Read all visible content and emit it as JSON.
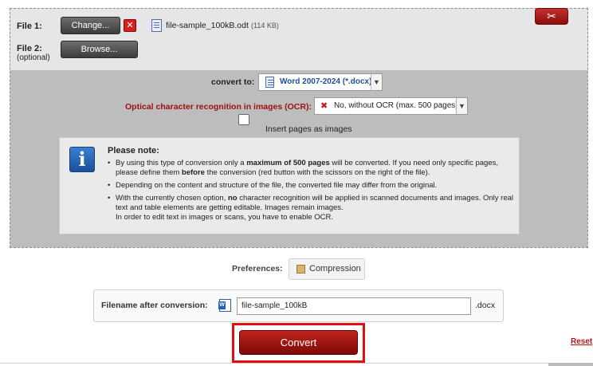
{
  "file1": {
    "label": "File 1:",
    "change_label": "Change...",
    "remove_icon": "x-icon",
    "file_name": "file-sample_100kB.odt",
    "file_size": "(114 KB)"
  },
  "file2": {
    "label": "File 2:",
    "optional_label": "(optional)",
    "browse_label": "Browse..."
  },
  "scissors_icon": "scissors-icon",
  "convert_to": {
    "label": "convert to:",
    "selected": "Word 2007-2024 (*.docx)"
  },
  "ocr": {
    "label": "Optical character recognition in images (OCR):",
    "selected": "No, without OCR (max. 500 pages)"
  },
  "insert_pages": {
    "label": "Insert pages as images",
    "checked": false
  },
  "note": {
    "title": "Please note:",
    "b1_a": "By using this type of conversion only a ",
    "b1_bold1": "maximum of 500 pages",
    "b1_b": " will be converted. If you need only specific pages, please define them ",
    "b1_bold2": "before",
    "b1_c": " the conversion (red button with the scissors on the right of the file).",
    "b2": "Depending on the content and structure of the file, the converted file may differ from the original.",
    "b3_a": "With the currently chosen option, ",
    "b3_bold": "no",
    "b3_b": " character recognition will be applied in scanned documents and images. Only real text and table elements are getting editable. Images remain images.",
    "b3_c": "In order to edit text in images or scans, you have to enable OCR."
  },
  "preferences": {
    "label": "Preferences:",
    "compression_label": "Compression"
  },
  "filename": {
    "label": "Filename after conversion:",
    "value": "file-sample_100kB",
    "extension": ".docx"
  },
  "convert_label": "Convert",
  "reset_label": "Reset",
  "colors": {
    "accent_red": "#b41515",
    "ocr_label": "#a01010",
    "select_text": "#1f4f9a",
    "info_blue": "#2a6bc4"
  }
}
